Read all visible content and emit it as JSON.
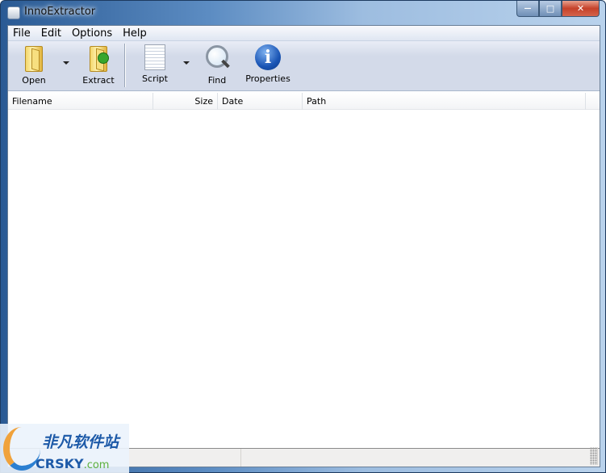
{
  "window": {
    "title": "InnoExtractor",
    "controls": {
      "minimize": "—",
      "maximize": "□",
      "close": "✕"
    }
  },
  "menu": [
    "File",
    "Edit",
    "Options",
    "Help"
  ],
  "toolbar": {
    "open": "Open",
    "extract": "Extract",
    "script": "Script",
    "find": "Find",
    "properties": "Properties",
    "info_glyph": "i"
  },
  "columns": [
    "Filename",
    "Size",
    "Date",
    "Path"
  ],
  "watermark": {
    "cn": "非凡软件站",
    "en": "CRSKY",
    "domain": ".com"
  }
}
